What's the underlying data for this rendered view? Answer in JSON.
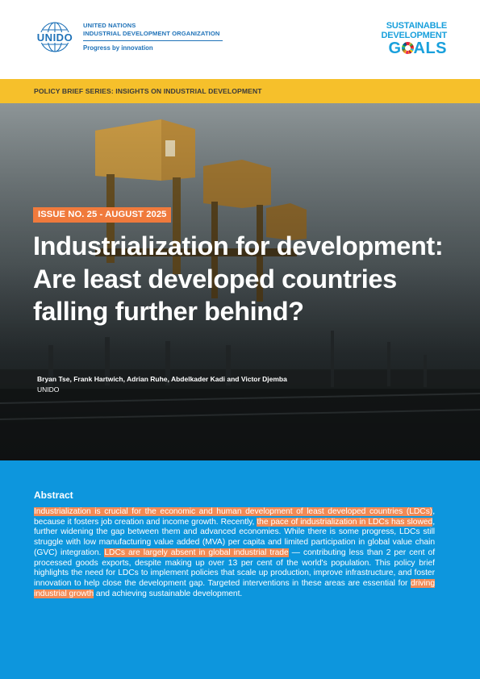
{
  "header": {
    "org_name_line1": "UNITED NATIONS",
    "org_name_line2": "INDUSTRIAL DEVELOPMENT ORGANIZATION",
    "tagline": "Progress by innovation",
    "logo_text": "UNIDO",
    "sdg_line1": "SUSTAINABLE",
    "sdg_line2": "DEVELOPMENT",
    "sdg_goals_g": "G",
    "sdg_goals_rest": "ALS"
  },
  "series": {
    "label": "POLICY BRIEF SERIES: INSIGHTS ON INDUSTRIAL DEVELOPMENT"
  },
  "cover": {
    "issue": "ISSUE NO. 25 - AUGUST 2025",
    "title": "Industrialization for development: Are least developed countries falling further behind?",
    "authors": "Bryan Tse, Frank Hartwich, Adrian Ruhe, Abdelkader Kadi and Victor Djemba",
    "affiliation": "UNIDO"
  },
  "abstract": {
    "heading": "Abstract",
    "segments": [
      {
        "text": "Industrialization is crucial for the economic and human development of least developed countries (LDCs)",
        "highlight": true
      },
      {
        "text": ", because it fosters job creation and income growth. Recently, ",
        "highlight": false
      },
      {
        "text": "the pace of industrialization in LDCs has slowed",
        "highlight": true
      },
      {
        "text": ", further widening the gap between them and advanced economies. While there is some progress, LDCs still struggle with low manufacturing value added (MVA) per capita and limited participation in global value chain (GVC) integration. ",
        "highlight": false
      },
      {
        "text": "LDCs are largely absent in global industrial trade",
        "highlight": true
      },
      {
        "text": " — contributing less than 2 per cent of processed goods exports, despite making up over 13 per cent of the world's population. This policy brief highlights the need for LDCs to implement policies that scale up production, improve infrastructure, and foster innovation to help close the development gap. Targeted interventions in these areas are essential for ",
        "highlight": false
      },
      {
        "text": "driving industrial growth",
        "highlight": true
      },
      {
        "text": " and achieving sustainable development.",
        "highlight": false
      }
    ]
  },
  "colors": {
    "accent_blue": "#0d96dd",
    "band_yellow": "#f6c02b",
    "badge_orange": "#f07a3c",
    "highlight_orange": "#f28a55"
  }
}
